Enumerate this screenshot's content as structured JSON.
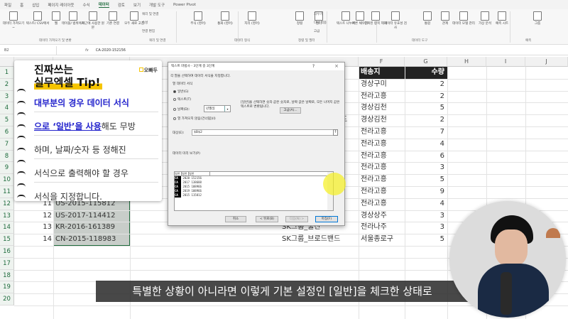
{
  "ribbon_tabs": [
    "파일",
    "홈",
    "삽입",
    "페이지 레이아웃",
    "수식",
    "데이터",
    "검토",
    "보기",
    "개발 도구",
    "Power Pivot"
  ],
  "active_tab": "데이터",
  "ribbon_buttons": [
    {
      "label": "데이터 가져오기 ~",
      "group": "get"
    },
    {
      "label": "텍스트/ CSV에서"
    },
    {
      "label": "웹"
    },
    {
      "label": "테이블/ 범위에서"
    },
    {
      "label": "최근에 사용한 원본"
    },
    {
      "label": "기존 연결"
    },
    {
      "label": "모두 새로 고침"
    },
    {
      "label": "주식 (영어)"
    },
    {
      "label": "통화 (영어)"
    },
    {
      "label": "지리 (영어)"
    },
    {
      "label": "조직 (영어)"
    },
    {
      "label": "정렬"
    },
    {
      "label": "필터"
    },
    {
      "label": "텍스트 나누기"
    },
    {
      "label": "빠른 채우기"
    },
    {
      "label": "중복된 항목 제거"
    },
    {
      "label": "데이터 유효성 검사"
    },
    {
      "label": "통합"
    },
    {
      "label": "관계"
    },
    {
      "label": "데이터 모델 관리"
    },
    {
      "label": "가상 분석"
    },
    {
      "label": "예측 시트"
    },
    {
      "label": "그룹"
    }
  ],
  "ribbon_small": [
    "쿼리 및 연결",
    "속성",
    "연결 편집",
    "지우기",
    "다시 적용",
    "고급"
  ],
  "ribbon_groups": [
    "데이터 가져오기 및 변환",
    "쿼리 및 연결",
    "데이터 형식",
    "정렬 및 필터",
    "데이터 도구",
    "예측"
  ],
  "formula_bar": {
    "name_box": "B2",
    "fx": "fx",
    "value": "CA-2020-152156"
  },
  "columns": [
    "F",
    "G",
    "H",
    "I",
    "J"
  ],
  "rows": [
    "1",
    "2",
    "3",
    "4",
    "5",
    "6",
    "7",
    "8",
    "9",
    "10",
    "11",
    "12",
    "13",
    "14",
    "15",
    "16",
    "17",
    "18",
    "19",
    "20"
  ],
  "col_a": [
    {
      "row": 12,
      "value": "11"
    },
    {
      "row": 13,
      "value": "12"
    },
    {
      "row": 14,
      "value": "13"
    },
    {
      "row": 15,
      "value": "14"
    }
  ],
  "col_b": [
    {
      "row": 12,
      "value": "US-2015-115812"
    },
    {
      "row": 13,
      "value": "US-2017-114412"
    },
    {
      "row": 14,
      "value": "KR-2016-161389"
    },
    {
      "row": 15,
      "value": "CN-2015-118983"
    }
  ],
  "col_e": [
    {
      "row": 5,
      "value": "드"
    },
    {
      "row": 14,
      "value": "SK그룹_물산"
    },
    {
      "row": 15,
      "value": "SK그룹_브로드밴드"
    }
  ],
  "col_f": [
    "배송지",
    "경상구미",
    "전라고흥",
    "경상김천",
    "경상김천",
    "전라고흥",
    "전라고흥",
    "전라고흥",
    "전라고흥",
    "전라고흥",
    "전라고흥",
    "전라고흥",
    "경상상주",
    "전라나주",
    "서울종로구"
  ],
  "col_g": [
    "수량",
    "2",
    "2",
    "5",
    "2",
    "7",
    "4",
    "6",
    "3",
    "5",
    "9",
    "4",
    "3",
    "3",
    "5"
  ],
  "tip": {
    "title1": "진짜쓰는",
    "title2": "실무엑셀 Tip!",
    "brand": "오빠두",
    "lines": [
      {
        "blue": "대부분의 경우 데이터 서식",
        "plain": ""
      },
      {
        "blue": "으로 ‘일반’을 사용",
        "plain": "해도 무방"
      },
      {
        "blue": "",
        "plain": "하며, 날짜/숫자 등 정해진"
      },
      {
        "blue": "",
        "plain": "서식으로 출력해야 할 경우"
      },
      {
        "blue": "",
        "plain": "서식을 지정합니다."
      }
    ]
  },
  "dialog": {
    "title": "텍스트 마법사 - 3단계 중 3단계",
    "help": "?",
    "close": "×",
    "instruction": "각 열을 선택하여 데이터 서식을 지정합니다.",
    "group_label": "열 데이터 서식",
    "options": [
      "일반(G)",
      "텍스트(T)",
      "날짜(D):",
      "열 가져오지 않음(건너뜀)(I)"
    ],
    "selected_option": "일반(G)",
    "date_format": "년월일",
    "description": "[일반]을 선택하면 숫자 값은 숫자로, 날짜 값은 날짜로, 모든 나머지 값은 텍스트로 변환됩니다.",
    "advanced": "고급(A)...",
    "dest_label": "대상(E):",
    "dest_value": "$B$2",
    "preview_label": "데이터 미리 보기(P)",
    "preview_header": [
      "일반",
      "일반",
      "일반"
    ],
    "preview_rows": [
      [
        "CA",
        "2020",
        "152156"
      ],
      [
        "CA",
        "2017",
        "138688"
      ],
      [
        "CA",
        "2015",
        "108966"
      ],
      [
        "CA",
        "2019",
        "108966"
      ],
      [
        "CA",
        "2015",
        "115812"
      ]
    ],
    "buttons": {
      "cancel": "취소",
      "back": "< 뒤로(B)",
      "next": "다음(N) >",
      "finish": "마침(F)"
    }
  },
  "caption": "특별한 상황이 아니라면 이렇게 기본 설정인 [일반]을 체크한 상태로",
  "colors": {
    "excel_green": "#1e6b3c",
    "tip_blue": "#2222cc",
    "tip_highlight": "#f5c400",
    "header_dark": "#222222"
  }
}
